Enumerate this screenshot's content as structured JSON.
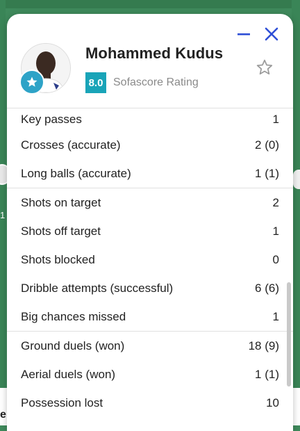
{
  "player": {
    "name": "Mohammed Kudus",
    "rating": "8.0",
    "rating_label": "Sofascore Rating"
  },
  "background": {
    "number": "1",
    "bottom_text": "e"
  },
  "icons": {
    "minimize": "minimize-icon",
    "close": "close-icon",
    "favorite": "star-outline-icon",
    "badge": "star-icon"
  },
  "colors": {
    "accent": "#2e4fd6",
    "rating_badge": "#19a4b8",
    "star_badge": "#2ea3c7",
    "pitch": "#3f8a5c"
  },
  "stat_groups": [
    [
      {
        "label": "Key passes",
        "value": "1"
      },
      {
        "label": "Crosses (accurate)",
        "value": "2 (0)"
      },
      {
        "label": "Long balls (accurate)",
        "value": "1 (1)"
      }
    ],
    [
      {
        "label": "Shots on target",
        "value": "2"
      },
      {
        "label": "Shots off target",
        "value": "1"
      },
      {
        "label": "Shots blocked",
        "value": "0"
      },
      {
        "label": "Dribble attempts (successful)",
        "value": "6 (6)"
      },
      {
        "label": "Big chances missed",
        "value": "1"
      }
    ],
    [
      {
        "label": "Ground duels (won)",
        "value": "18 (9)"
      },
      {
        "label": "Aerial duels (won)",
        "value": "1 (1)"
      },
      {
        "label": "Possession lost",
        "value": "10"
      }
    ]
  ]
}
